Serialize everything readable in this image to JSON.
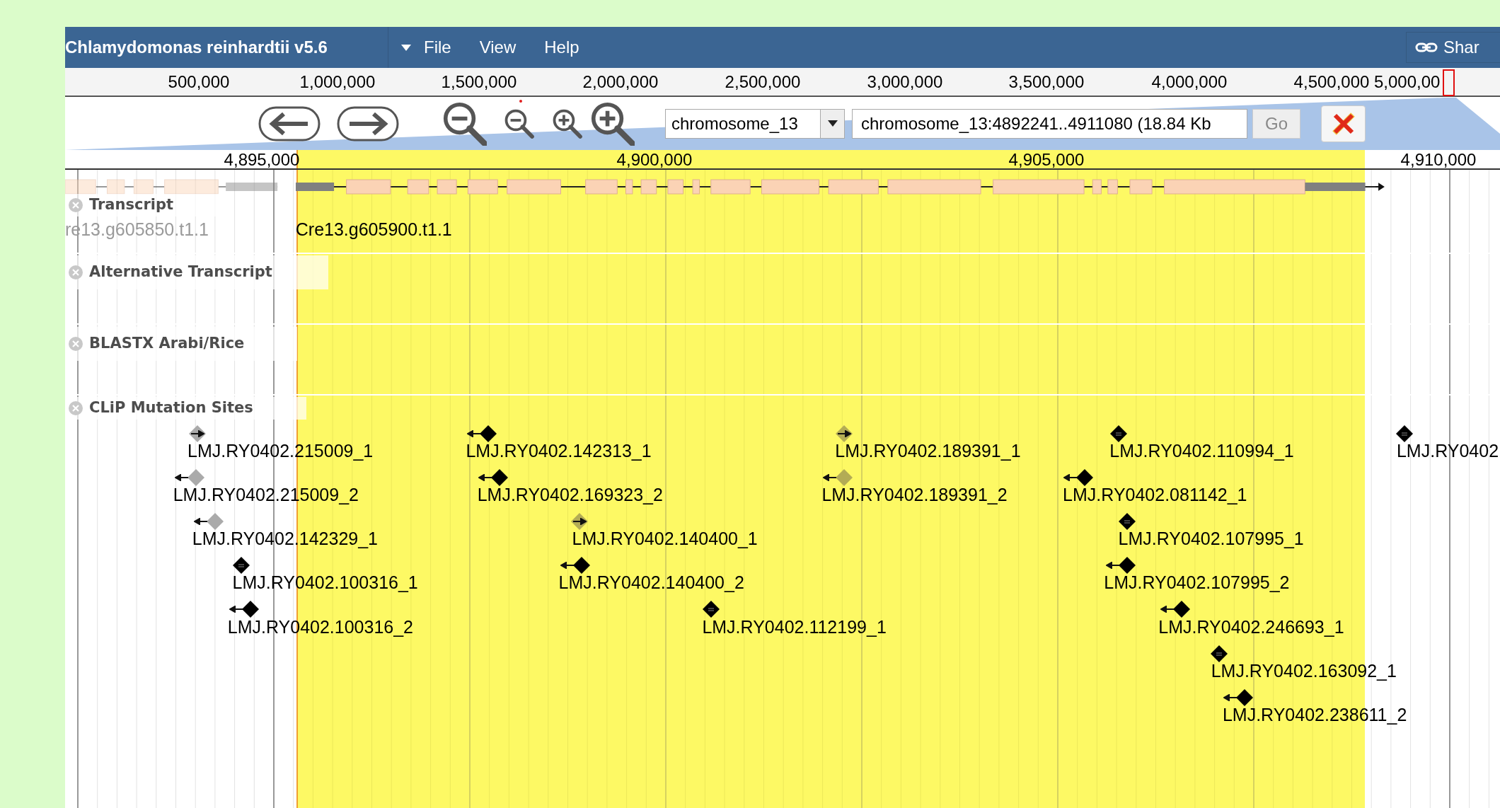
{
  "menu_bar": {
    "title": "Chlamydomonas reinhardtii v5.6",
    "menus": [
      "File",
      "View",
      "Help"
    ],
    "share_button": "Shar"
  },
  "overview_ruler": {
    "labels": [
      "500,000",
      "1,000,000",
      "1,500,000",
      "2,000,000",
      "2,500,000",
      "3,000,000",
      "3,500,000",
      "4,000,000",
      "4,500,000",
      "5,000,00"
    ]
  },
  "navigation": {
    "reference_sequence": "chromosome_13",
    "location": "chromosome_13:4892241..4911080 (18.84 Kb",
    "go_button": "Go"
  },
  "detail_ruler": {
    "labels": [
      "4,895,000",
      "4,900,000",
      "4,905,000",
      "4,910,000"
    ]
  },
  "tracks": [
    {
      "label": "Transcript",
      "kind": "gene",
      "features": [
        {
          "name": "re13.g605850.t1.1"
        },
        {
          "name": "Cre13.g605900.t1.1"
        }
      ]
    },
    {
      "label": "Alternative Transcript"
    },
    {
      "label": "BLASTX Arabi/Rice"
    },
    {
      "label": "CLiP Mutation Sites",
      "kind": "site",
      "features": [
        {
          "name": "LMJ.RY0402.215009_1",
          "kind": "forward",
          "color": "#aaaaaa"
        },
        {
          "name": "LMJ.RY0402.142313_1",
          "kind": "reverse",
          "color": "#000000"
        },
        {
          "name": "LMJ.RY0402.189391_1",
          "kind": "forward",
          "color": "#b3ac55"
        },
        {
          "name": "LMJ.RY0402.110994_1",
          "kind": "unstranded",
          "color": "#000000"
        },
        {
          "name": "LMJ.RY0402",
          "kind": "unstranded",
          "color": "#000000"
        },
        {
          "name": "LMJ.RY0402.215009_2",
          "kind": "reverse",
          "color": "#aaaaaa"
        },
        {
          "name": "LMJ.RY0402.169323_2",
          "kind": "reverse",
          "color": "#000000"
        },
        {
          "name": "LMJ.RY0402.189391_2",
          "kind": "reverse",
          "color": "#b3ac55"
        },
        {
          "name": "LMJ.RY0402.081142_1",
          "kind": "reverse",
          "color": "#000000"
        },
        {
          "name": "LMJ.RY0402.142329_1",
          "kind": "reverse",
          "color": "#aaaaaa"
        },
        {
          "name": "LMJ.RY0402.140400_1",
          "kind": "forward",
          "color": "#b3ac55"
        },
        {
          "name": "LMJ.RY0402.107995_1",
          "kind": "unstranded",
          "color": "#000000"
        },
        {
          "name": "LMJ.RY0402.100316_1",
          "kind": "unstranded",
          "color": "#000000"
        },
        {
          "name": "LMJ.RY0402.140400_2",
          "kind": "reverse",
          "color": "#000000"
        },
        {
          "name": "LMJ.RY0402.107995_2",
          "kind": "reverse",
          "color": "#000000"
        },
        {
          "name": "LMJ.RY0402.100316_2",
          "kind": "reverse",
          "color": "#000000"
        },
        {
          "name": "LMJ.RY0402.112199_1",
          "kind": "unstranded",
          "color": "#000000"
        },
        {
          "name": "LMJ.RY0402.246693_1",
          "kind": "reverse",
          "color": "#000000"
        },
        {
          "name": "LMJ.RY0402.163092_1",
          "kind": "unstranded",
          "color": "#000000"
        },
        {
          "name": "LMJ.RY0402.238611_2",
          "kind": "reverse",
          "color": "#000000"
        }
      ]
    }
  ]
}
